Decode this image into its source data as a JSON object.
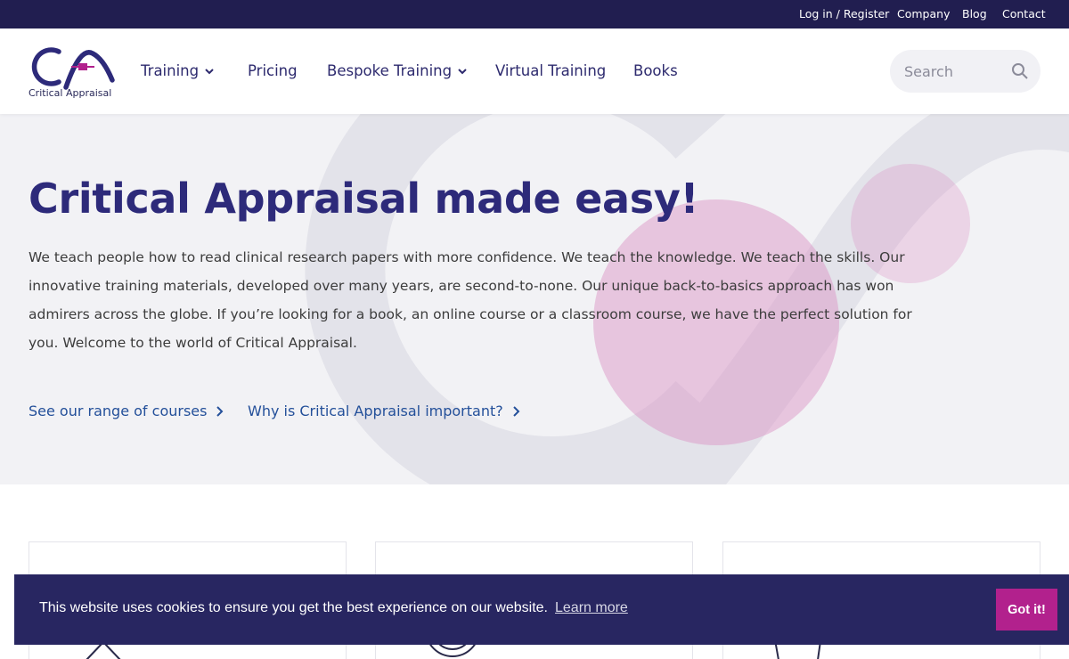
{
  "topbar": {
    "links": [
      "Log in / Register",
      "Company",
      "Blog",
      "Contact"
    ]
  },
  "header": {
    "logo_text": "Critical Appraisal",
    "nav": [
      "Training",
      "Pricing",
      "Bespoke Training",
      "Virtual Training",
      "Books"
    ],
    "search_placeholder": "Search"
  },
  "hero": {
    "title": "Critical Appraisal made easy!",
    "body": "We teach people how to read clinical research papers with more confidence. We teach the knowledge. We teach the skills. Our innovative training materials, developed over many years, are second-to-none. Our unique back-to-basics approach has won admirers across the globe. If you’re looking for a book, an online course or a classroom course, we have the perfect solution for you. Welcome to the world of Critical Appraisal.",
    "link_courses": "See our range of courses",
    "link_why": "Why is Critical Appraisal important?"
  },
  "cards": {
    "icons": [
      "presentation-board-icon",
      "medal-icon",
      "pencil-pot-icon"
    ]
  },
  "cookie": {
    "message": "This website uses cookies to ensure you get the best experience on our website.",
    "learn_more": "Learn more",
    "accept": "Got it!"
  },
  "colors": {
    "brand_navy": "#211e50",
    "heading": "#2d2a7a",
    "link": "#24509a",
    "accent_pink": "#b2218d"
  }
}
